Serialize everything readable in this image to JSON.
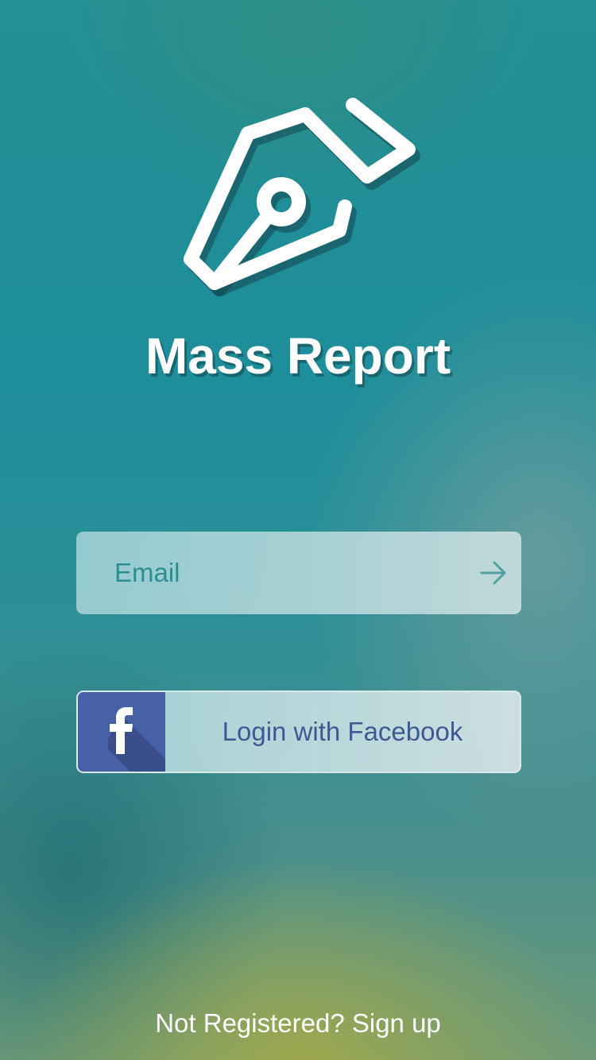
{
  "app": {
    "title": "Mass Report",
    "logo_icon": "fountain-pen-nib-icon"
  },
  "email": {
    "placeholder": "Email",
    "submit_icon": "arrow-right-icon"
  },
  "facebook": {
    "label": "Login with Facebook",
    "icon": "facebook-icon",
    "brand_color": "#4661a6"
  },
  "footer": {
    "signup_text": "Not Registered? Sign up"
  }
}
